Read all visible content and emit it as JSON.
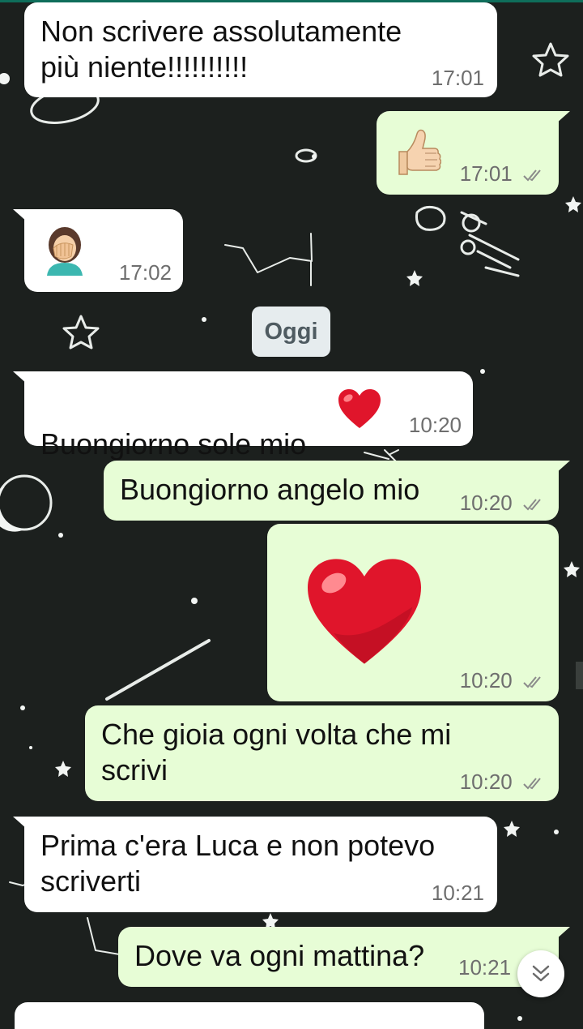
{
  "date_divider": "Oggi",
  "colors": {
    "wallpaper": "#1c201e",
    "incoming_bubble": "#ffffff",
    "outgoing_bubble": "#e7fdd6",
    "date_chip": "#e6ecee",
    "tick_color": "#8a8a8a"
  },
  "messages": [
    {
      "direction": "incoming",
      "text": "Non scrivere assolutamente\npiù niente!!!!!!!!!!",
      "time": "17:01"
    },
    {
      "direction": "outgoing",
      "emoji": "thumbs-up",
      "time": "17:01",
      "status": "sent"
    },
    {
      "direction": "incoming",
      "emoji": "woman-facepalming",
      "time": "17:02"
    },
    {
      "direction": "incoming",
      "text": "Buongiorno sole mio",
      "emoji": "red-heart",
      "time": "10:20"
    },
    {
      "direction": "outgoing",
      "text": "Buongiorno angelo mio",
      "time": "10:20",
      "status": "sent"
    },
    {
      "direction": "outgoing",
      "emoji": "red-heart",
      "time": "10:20",
      "status": "sent"
    },
    {
      "direction": "outgoing",
      "text": "Che gioia ogni volta che mi\nscrivi",
      "time": "10:20",
      "status": "sent"
    },
    {
      "direction": "incoming",
      "text": "Prima c'era Luca e non potevo\nscriverti",
      "time": "10:21"
    },
    {
      "direction": "outgoing",
      "text": "Dove va ogni mattina?",
      "time": "10:21",
      "status": "sent"
    }
  ],
  "icons": {
    "scroll_button": "chevrons-down-icon",
    "read_status": "double-check-icon"
  }
}
